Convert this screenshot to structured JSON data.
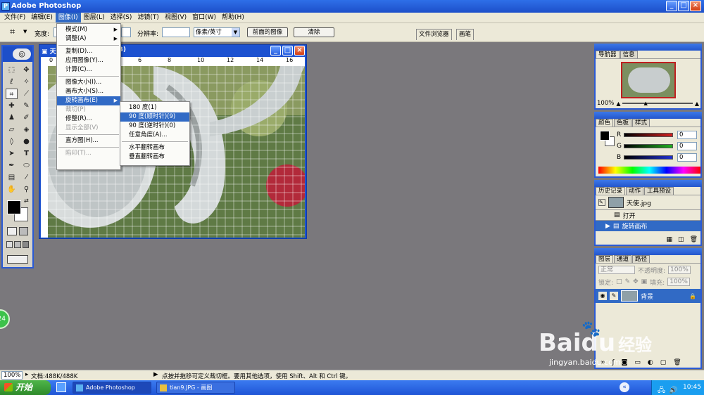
{
  "app": {
    "title": "Adobe Photoshop",
    "icon": "photoshop-icon",
    "window_buttons": [
      "_",
      "□",
      "×"
    ]
  },
  "menubar": [
    "文件(F)",
    "编辑(E)",
    "图像(I)",
    "图层(L)",
    "选择(S)",
    "滤镜(T)",
    "视图(V)",
    "窗口(W)",
    "帮助(H)"
  ],
  "options_bar": {
    "width_label": "宽度:",
    "resolution_label": "分辨率:",
    "unit_select": "像素/英寸",
    "front_image_button": "前面的图像",
    "clear_button": "清除",
    "tabs": [
      "文件浏览器",
      "画笔"
    ]
  },
  "image_menu": [
    {
      "label": "模式(M)",
      "submenu": true
    },
    {
      "label": "调整(A)",
      "submenu": true
    },
    {
      "sep": true
    },
    {
      "label": "复制(D)..."
    },
    {
      "label": "应用图像(Y)..."
    },
    {
      "label": "计算(C)..."
    },
    {
      "sep": true
    },
    {
      "label": "图像大小(I)..."
    },
    {
      "label": "画布大小(S)..."
    },
    {
      "label": "旋转画布(E)",
      "submenu": true,
      "highlighted": true
    },
    {
      "label": "裁切(P)",
      "disabled": true
    },
    {
      "label": "修整(R)..."
    },
    {
      "label": "显示全部(V)",
      "disabled": true
    },
    {
      "sep": true
    },
    {
      "label": "直方图(H)..."
    },
    {
      "sep": true
    },
    {
      "label": "陷印(T)...",
      "disabled": true
    }
  ],
  "rotate_submenu": [
    {
      "label": "180 度(1)"
    },
    {
      "label": "90 度(顺时针)(9)",
      "highlighted": true
    },
    {
      "label": "90 度(逆时针)(0)"
    },
    {
      "label": "任意角度(A)..."
    },
    {
      "sep": true
    },
    {
      "label": "水平翻转画布"
    },
    {
      "label": "垂直翻转画布"
    }
  ],
  "document": {
    "title_prefix": "天",
    "title_suffix": "B)",
    "ruler_labels": [
      "0",
      "2",
      "4",
      "6",
      "8",
      "10",
      "12",
      "14",
      "16"
    ]
  },
  "navigator": {
    "tabs": [
      "导航器",
      "信息"
    ],
    "zoom": "100%"
  },
  "color_panel": {
    "tabs": [
      "颜色",
      "色板",
      "样式"
    ],
    "channels": [
      {
        "label": "R",
        "value": "0",
        "color": "#d42020"
      },
      {
        "label": "G",
        "value": "0",
        "color": "#20b020"
      },
      {
        "label": "B",
        "value": "0",
        "color": "#2030d0"
      }
    ]
  },
  "history_panel": {
    "tabs": [
      "历史记录",
      "动作",
      "工具预设"
    ],
    "snapshot": "天使.jpg",
    "items": [
      "打开",
      "旋转画布"
    ]
  },
  "layers_panel": {
    "tabs": [
      "图层",
      "通道",
      "路径"
    ],
    "blend_mode": "正常",
    "opacity_label": "不透明度:",
    "opacity": "100%",
    "lock_label": "锁定:",
    "fill_label": "填充:",
    "fill": "100%",
    "layer_name": "背景"
  },
  "statusbar": {
    "zoom": "100%",
    "doc": "文档:488K/488K",
    "hint": "点按并拖移可定义裁切框。要用其他选项，使用 Shift、Alt 和 Ctrl 键。"
  },
  "taskbar": {
    "start": "开始",
    "tasks": [
      "Adobe Photoshop",
      "tian9.JPG - 画图"
    ],
    "clock": "10:45"
  },
  "badge": "24",
  "watermark": {
    "brand": "Baidu",
    "cn": "经验",
    "url": "jingyan.baidu.com"
  }
}
